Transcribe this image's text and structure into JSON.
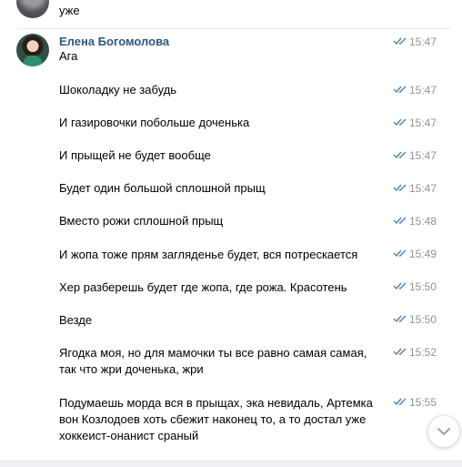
{
  "previous_message": {
    "text": "уже"
  },
  "author": {
    "name": "Елена Богомолова"
  },
  "messages": [
    {
      "text": "Ага",
      "time": "15:47"
    },
    {
      "text": "Шоколадку не забудь",
      "time": "15:47"
    },
    {
      "text": "И газировочки побольше доченька",
      "time": "15:47"
    },
    {
      "text": "И прыщей не будет вообще",
      "time": "15:47"
    },
    {
      "text": "Будет один большой сплошной прыщ",
      "time": "15:47"
    },
    {
      "text": "Вместо рожи сплошной прыщ",
      "time": "15:48"
    },
    {
      "text": "И жопа тоже прям загляденье будет, вся потрескается",
      "time": "15:49"
    },
    {
      "text": "Хер разберешь будет где жопа, где рожа. Красотень",
      "time": "15:50"
    },
    {
      "text": "Везде",
      "time": "15:50"
    },
    {
      "text": "Ягодка моя, но для мамочки ты все равно самая самая, так что жри доченька, жри",
      "time": "15:52"
    },
    {
      "text": "Подумаешь морда вся в прыщах, эка невидаль, Артемка вон Козлодоев хоть сбежит наконец то, а то достал уже хоккеист-онанист сраный",
      "time": "15:55"
    }
  ],
  "colors": {
    "author": "#2a5885",
    "time": "#939393",
    "ticks": "#5181b8"
  },
  "icons": {
    "read_ticks": "double-check-icon",
    "scroll_down": "chevron-down-icon"
  }
}
